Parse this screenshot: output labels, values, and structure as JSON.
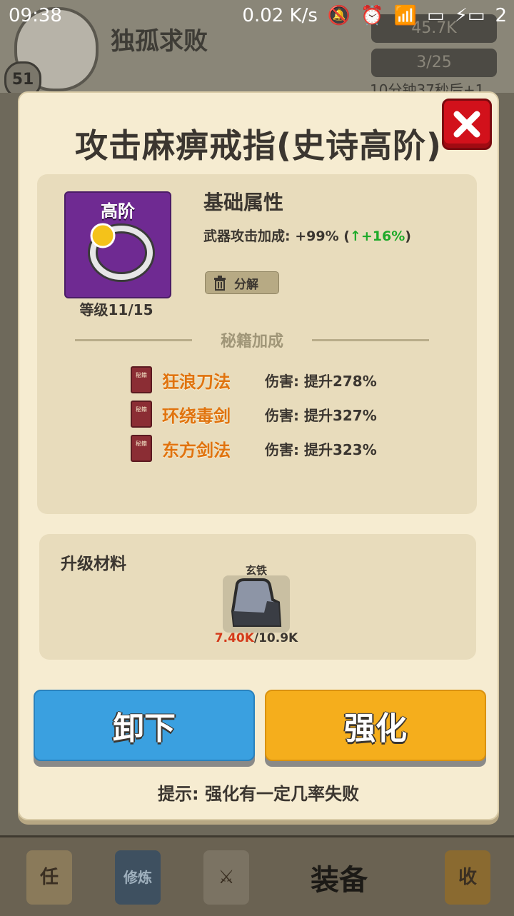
{
  "status_bar": {
    "time": "09:38",
    "network_speed": "0.02 K/s",
    "battery_level": "2"
  },
  "background": {
    "player_name": "独孤求败",
    "player_level": "51",
    "resource_gold": "45.7K",
    "resource_energy": "3/25",
    "timer_text": "10分钟37秒后+1",
    "nav": {
      "tasks_label": "任",
      "train_label": "修炼",
      "equip_label": "装备",
      "collect_label": "收"
    }
  },
  "modal": {
    "title": "攻击麻痹戒指(史诗高阶)",
    "item": {
      "tier_label": "高阶",
      "level_text": "等级11/15"
    },
    "base_attr": {
      "heading": "基础属性",
      "stat_text": "武器攻击加成: +99% (",
      "stat_up": "↑+16%",
      "stat_close": ")"
    },
    "decompose_label": "分解",
    "manual_section": {
      "heading": "秘籍加成",
      "book_label": "秘籍",
      "items": [
        {
          "name": "狂浪刀法",
          "effect": "伤害: 提升278%"
        },
        {
          "name": "环绕毒剑",
          "effect": "伤害: 提升327%"
        },
        {
          "name": "东方剑法",
          "effect": "伤害: 提升323%"
        }
      ]
    },
    "materials": {
      "heading": "升级材料",
      "item_name": "玄铁",
      "have": "7.40K",
      "need": "/10.9K"
    },
    "buttons": {
      "unequip": "卸下",
      "enhance": "强化"
    },
    "hint": "提示: 强化有一定几率失败"
  },
  "colors": {
    "modal_bg": "#f6ecd1",
    "panel_bg": "#e8dcbc",
    "unequip_btn": "#3aa0e0",
    "enhance_btn": "#f5ae1c",
    "close_btn": "#d2111b",
    "manual_name": "#e0730e",
    "stat_up": "#1faa2a"
  }
}
